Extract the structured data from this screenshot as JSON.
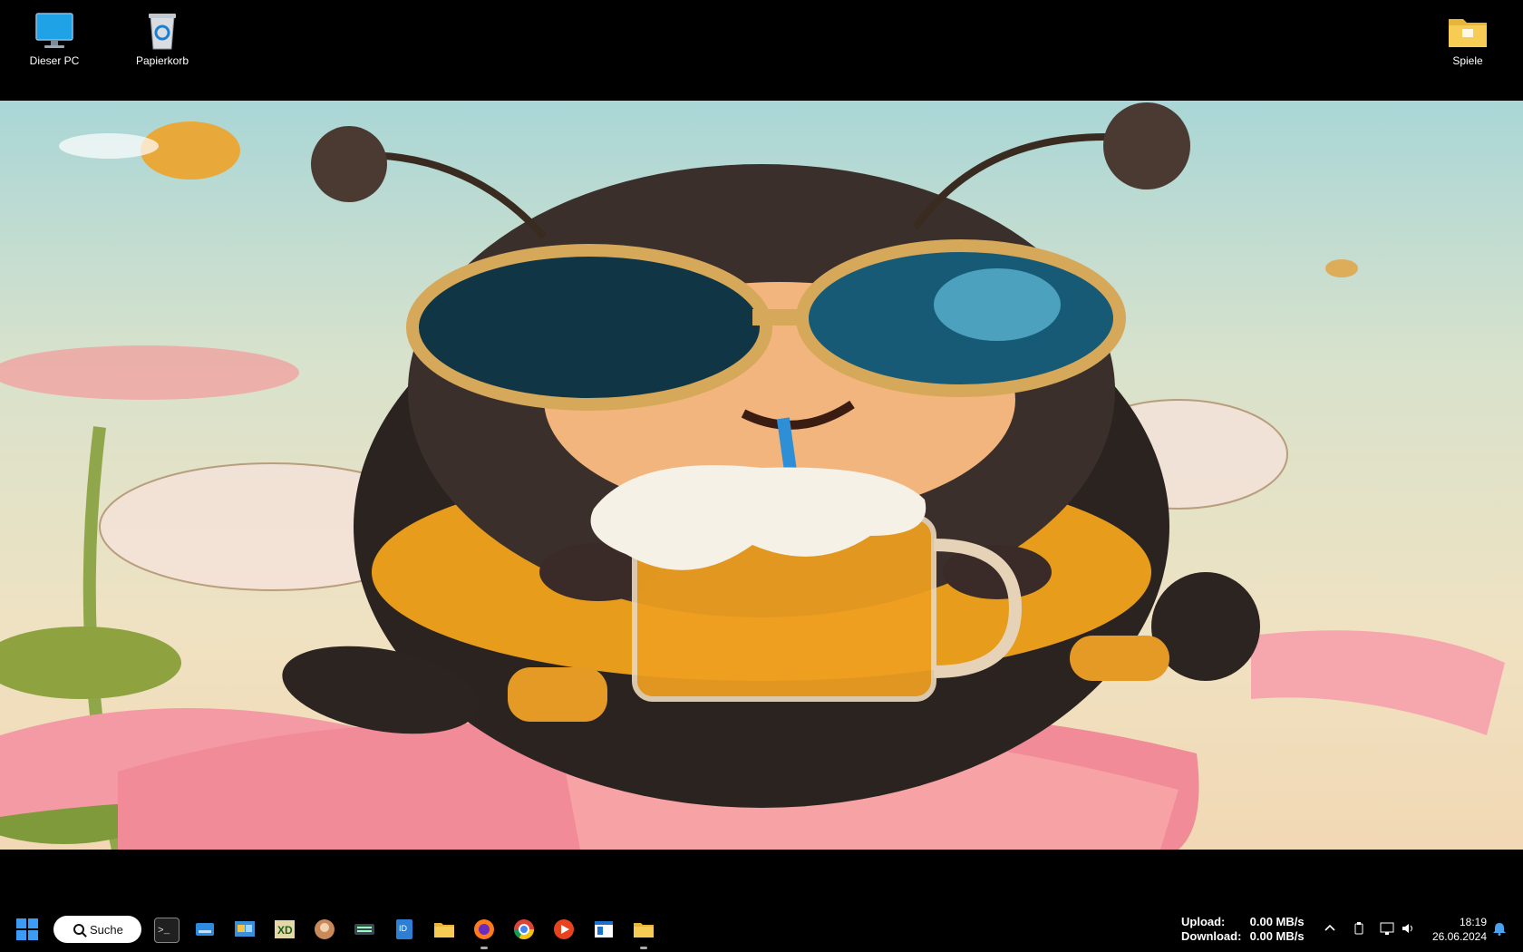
{
  "desktop": {
    "icons": [
      {
        "label": "Dieser PC",
        "icon": "monitor-icon"
      },
      {
        "label": "Papierkorb",
        "icon": "recycle-bin-icon"
      },
      {
        "label": "Spiele",
        "icon": "folder-icon"
      }
    ],
    "wallpaper": "bee-with-sunglasses-and-beer"
  },
  "taskbar": {
    "start_icon": "windows-start-icon",
    "search_label": "Suche",
    "apps": [
      {
        "icon": "terminal-icon"
      },
      {
        "icon": "disk-drive-icon"
      },
      {
        "icon": "control-panel-icon"
      },
      {
        "icon": "xd-app-icon"
      },
      {
        "icon": "photo-viewer-icon"
      },
      {
        "icon": "keyboard-icon"
      },
      {
        "icon": "id-card-icon"
      },
      {
        "icon": "file-explorer-icon"
      },
      {
        "icon": "firefox-icon"
      },
      {
        "icon": "chrome-icon"
      },
      {
        "icon": "media-player-icon"
      },
      {
        "icon": "window-app-icon"
      },
      {
        "icon": "folder-icon"
      }
    ],
    "network": {
      "upload_label": "Upload:",
      "upload_value": "0.00 MB/s",
      "download_label": "Download:",
      "download_value": "0.00 MB/s"
    },
    "tray": [
      "chevron-up-icon",
      "usb-icon",
      "network-icon",
      "speaker-icon"
    ],
    "clock": {
      "time": "18:19",
      "date": "26.06.2024"
    },
    "notification_icon": "bell-icon"
  },
  "colors": {
    "accent": "#3a9cf5",
    "taskbar": "#000000"
  }
}
